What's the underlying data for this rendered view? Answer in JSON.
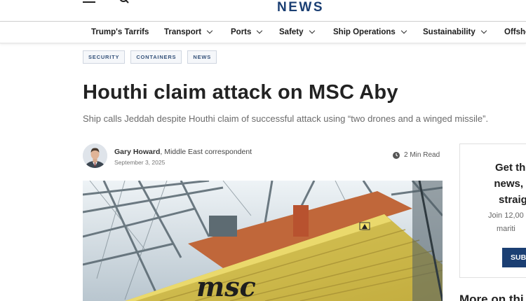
{
  "header": {
    "brand": "NEWS"
  },
  "nav": {
    "items": [
      {
        "label": "Trump's Tarrifs",
        "has_dropdown": false
      },
      {
        "label": "Transport",
        "has_dropdown": true
      },
      {
        "label": "Ports",
        "has_dropdown": true
      },
      {
        "label": "Safety",
        "has_dropdown": true
      },
      {
        "label": "Ship Operations",
        "has_dropdown": true
      },
      {
        "label": "Sustainability",
        "has_dropdown": true
      },
      {
        "label": "Offsho",
        "has_dropdown": false
      }
    ]
  },
  "article": {
    "tags": [
      "SECURITY",
      "CONTAINERS",
      "NEWS"
    ],
    "title": "Houthi claim attack on MSC Aby",
    "subtitle": "Ship calls Jeddah despite Houthi claim of successful attack using “two drones and a winged missile”.",
    "author": {
      "name": "Gary Howard",
      "role": ", Middle East correspondent",
      "date": "September 3, 2025"
    },
    "read_time": "2 Min Read",
    "hero_logo_text": "msc"
  },
  "sidebar": {
    "card": {
      "title_lines": [
        "Get the l",
        "news, an",
        "straigh"
      ],
      "body_lines": [
        "Join 12,00",
        "mariti"
      ],
      "button_label": "SUB"
    },
    "more_heading": "More on thi"
  },
  "colors": {
    "brand": "#1b3f73",
    "tag_text": "#35527a",
    "container_yellow": "#d9c75a"
  }
}
